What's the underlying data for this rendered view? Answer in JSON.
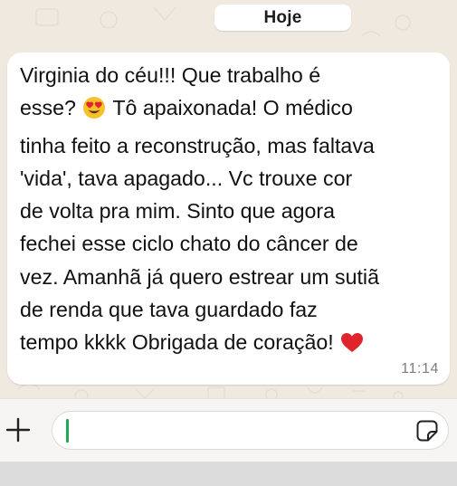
{
  "chat": {
    "date_label": "Hoje",
    "message": {
      "text_before_emoji": "Virginia do céu!!! Que trabalho é\nesse? ",
      "emoji_1": "smiling-face-with-heart-eyes",
      "text_after_emoji": " Tô apaixonada! O médico\ntinha feito a reconstrução, mas faltava\n'vida', tava apagado... Vc trouxe cor\nde volta pra mim. Sinto que agora\nfechei esse ciclo chato do câncer de\nvez. Amanhã já quero estrear um sutiã\nde renda que tava guardado faz\ntempo kkkk Obrigada de coração! ",
      "emoji_2": "red-heart",
      "time": "11:14"
    }
  },
  "composer": {
    "attach_icon": "plus-icon",
    "sticker_icon": "sticker-icon",
    "input_value": ""
  },
  "colors": {
    "wallpaper": "#efe9df",
    "bubble": "#ffffff",
    "caret": "#1faa59",
    "heart": "#e0242b",
    "emoji_face": "#f6c12b"
  }
}
